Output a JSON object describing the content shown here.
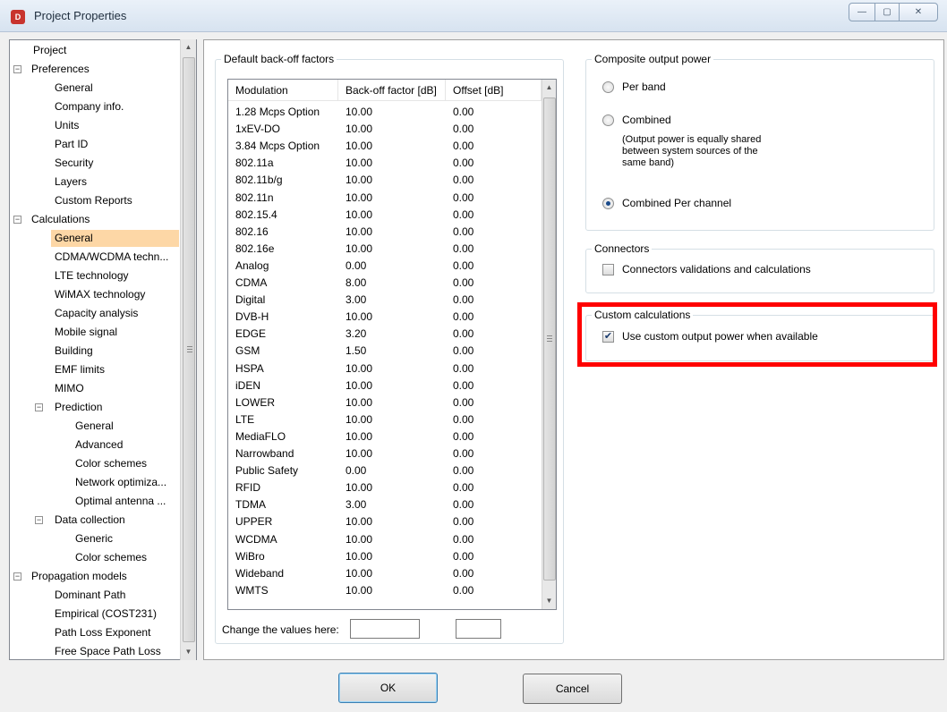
{
  "window": {
    "title": "Project Properties",
    "icon_glyph": "D"
  },
  "titlebar_buttons": {
    "minimize": "—",
    "maximize": "▢",
    "close": "✕"
  },
  "tree": [
    {
      "label": "Project",
      "level": 0,
      "expander": ""
    },
    {
      "label": "Preferences",
      "level": 0,
      "expander": "−"
    },
    {
      "label": "General",
      "level": 1,
      "expander": ""
    },
    {
      "label": "Company info.",
      "level": 1,
      "expander": ""
    },
    {
      "label": "Units",
      "level": 1,
      "expander": ""
    },
    {
      "label": "Part ID",
      "level": 1,
      "expander": ""
    },
    {
      "label": "Security",
      "level": 1,
      "expander": ""
    },
    {
      "label": "Layers",
      "level": 1,
      "expander": ""
    },
    {
      "label": "Custom Reports",
      "level": 1,
      "expander": ""
    },
    {
      "label": "Calculations",
      "level": 0,
      "expander": "−"
    },
    {
      "label": "General",
      "level": 1,
      "expander": "",
      "selected": true
    },
    {
      "label": "CDMA/WCDMA techn...",
      "level": 1,
      "expander": ""
    },
    {
      "label": "LTE technology",
      "level": 1,
      "expander": ""
    },
    {
      "label": "WiMAX technology",
      "level": 1,
      "expander": ""
    },
    {
      "label": "Capacity analysis",
      "level": 1,
      "expander": ""
    },
    {
      "label": "Mobile signal",
      "level": 1,
      "expander": ""
    },
    {
      "label": "Building",
      "level": 1,
      "expander": ""
    },
    {
      "label": "EMF limits",
      "level": 1,
      "expander": ""
    },
    {
      "label": "MIMO",
      "level": 1,
      "expander": ""
    },
    {
      "label": "Prediction",
      "level": 1,
      "expander": "−"
    },
    {
      "label": "General",
      "level": 2,
      "expander": ""
    },
    {
      "label": "Advanced",
      "level": 2,
      "expander": ""
    },
    {
      "label": "Color schemes",
      "level": 2,
      "expander": ""
    },
    {
      "label": "Network optimiza...",
      "level": 2,
      "expander": ""
    },
    {
      "label": "Optimal antenna ...",
      "level": 2,
      "expander": ""
    },
    {
      "label": "Data collection",
      "level": 1,
      "expander": "−"
    },
    {
      "label": "Generic",
      "level": 2,
      "expander": ""
    },
    {
      "label": "Color schemes",
      "level": 2,
      "expander": ""
    },
    {
      "label": "Propagation models",
      "level": 0,
      "expander": "−"
    },
    {
      "label": "Dominant Path",
      "level": 1,
      "expander": ""
    },
    {
      "label": "Empirical (COST231)",
      "level": 1,
      "expander": ""
    },
    {
      "label": "Path Loss Exponent",
      "level": 1,
      "expander": ""
    },
    {
      "label": "Free Space Path Loss",
      "level": 1,
      "expander": ""
    }
  ],
  "backoff": {
    "group_title": "Default back-off factors",
    "columns": [
      "Modulation",
      "Back-off factor [dB]",
      "Offset [dB]"
    ],
    "rows": [
      [
        "1.28 Mcps Option",
        "10.00",
        "0.00"
      ],
      [
        "1xEV-DO",
        "10.00",
        "0.00"
      ],
      [
        "3.84 Mcps Option",
        "10.00",
        "0.00"
      ],
      [
        "802.11a",
        "10.00",
        "0.00"
      ],
      [
        "802.11b/g",
        "10.00",
        "0.00"
      ],
      [
        "802.11n",
        "10.00",
        "0.00"
      ],
      [
        "802.15.4",
        "10.00",
        "0.00"
      ],
      [
        "802.16",
        "10.00",
        "0.00"
      ],
      [
        "802.16e",
        "10.00",
        "0.00"
      ],
      [
        "Analog",
        "0.00",
        "0.00"
      ],
      [
        "CDMA",
        "8.00",
        "0.00"
      ],
      [
        "Digital",
        "3.00",
        "0.00"
      ],
      [
        "DVB-H",
        "10.00",
        "0.00"
      ],
      [
        "EDGE",
        "3.20",
        "0.00"
      ],
      [
        "GSM",
        "1.50",
        "0.00"
      ],
      [
        "HSPA",
        "10.00",
        "0.00"
      ],
      [
        "iDEN",
        "10.00",
        "0.00"
      ],
      [
        "LOWER",
        "10.00",
        "0.00"
      ],
      [
        "LTE",
        "10.00",
        "0.00"
      ],
      [
        "MediaFLO",
        "10.00",
        "0.00"
      ],
      [
        "Narrowband",
        "10.00",
        "0.00"
      ],
      [
        "Public Safety",
        "0.00",
        "0.00"
      ],
      [
        "RFID",
        "10.00",
        "0.00"
      ],
      [
        "TDMA",
        "3.00",
        "0.00"
      ],
      [
        "UPPER",
        "10.00",
        "0.00"
      ],
      [
        "WCDMA",
        "10.00",
        "0.00"
      ],
      [
        "WiBro",
        "10.00",
        "0.00"
      ],
      [
        "Wideband",
        "10.00",
        "0.00"
      ],
      [
        "WMTS",
        "10.00",
        "0.00"
      ]
    ],
    "change_label": "Change the values here:",
    "backoff_input_value": "",
    "offset_input_value": ""
  },
  "composite": {
    "group_title": "Composite output power",
    "options": [
      {
        "label": "Per band",
        "checked": false
      },
      {
        "label": "Combined",
        "checked": false
      },
      {
        "label": "Combined Per channel",
        "checked": true
      }
    ],
    "combined_note": [
      "(Output power is equally shared",
      "between system sources of the",
      "same band)"
    ]
  },
  "connectors": {
    "group_title": "Connectors",
    "checkbox_label": "Connectors validations and calculations",
    "checked": false
  },
  "custom_calc": {
    "group_title": "Custom calculations",
    "checkbox_label": "Use custom output power when available",
    "checked": true
  },
  "buttons": {
    "ok": "OK",
    "cancel": "Cancel"
  },
  "colors": {
    "selection": "#fdd7a6",
    "highlight": "#ff0000"
  }
}
